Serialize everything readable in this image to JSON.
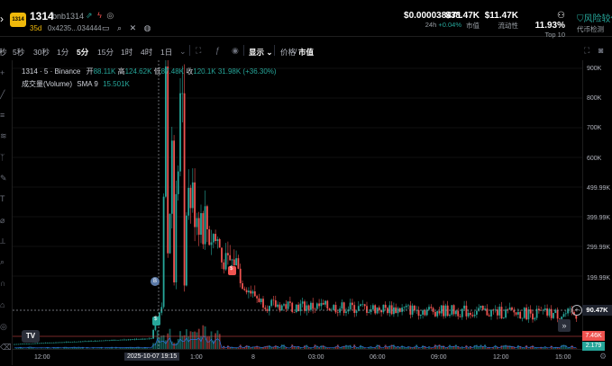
{
  "header": {
    "logo_text": "1314",
    "symbol": "1314",
    "pair": "bnb1314",
    "age": "35d",
    "address": "0x4235...034444",
    "stats": [
      {
        "value": "$0.000038471",
        "label_prefix": "24h",
        "label": "+0.04%"
      },
      {
        "value": "$38.47K",
        "label": "市值"
      },
      {
        "value": "$11.47K",
        "label": "流动性"
      },
      {
        "value": "11.93%",
        "label": "Top 10"
      }
    ],
    "risk_label": "风险较低",
    "risk_sub": "代币检测"
  },
  "toolbar": {
    "intervals": [
      "秒",
      "5秒",
      "30秒",
      "1分",
      "5分",
      "15分",
      "1时",
      "4时",
      "1日"
    ],
    "active_interval": "5分",
    "display_label": "显示",
    "price_label": "价格",
    "mcap_label": "市值"
  },
  "chart": {
    "title": "1314 · 5 · Binance",
    "o_label": "开",
    "o": "88.11K",
    "h_label": "高",
    "h": "124.62K",
    "l_label": "低",
    "l": "87.48K",
    "c_label": "收",
    "c": "120.1K",
    "change": "31.98K (+36.30%)",
    "volume_label": "成交量(Volume)",
    "sma_label": "SMA 9",
    "sma_value": "15.501K",
    "price_ticks": [
      "900K",
      "800K",
      "700K",
      "600K",
      "499.99K",
      "399.99K",
      "299.99K",
      "199.99K"
    ],
    "current_price": "90.47K",
    "volume_value": "7.46K",
    "volume_sma": "2.179",
    "time_ticks": [
      "12:00",
      "8",
      "03:00",
      "06:00",
      "09:00",
      "12:00",
      "15:00"
    ],
    "crosshair_time": "2025-10-07  19:15",
    "crosshair_after": "1:00",
    "tv_logo": "TV",
    "colors": {
      "up": "#26a69a",
      "down": "#ef5350",
      "sma": "#3179f5"
    }
  },
  "chart_data": {
    "type": "candlestick",
    "ylabel": "市值",
    "ylim": [
      0,
      900000
    ],
    "candles_approx": "pre-launch flat near 10-20K, spike to ~830K around 19:30, decay to ~250-300K, settling ~90K"
  }
}
